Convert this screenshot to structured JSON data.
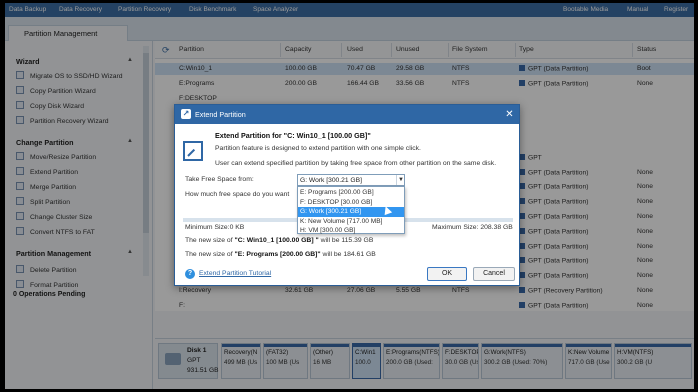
{
  "menu": [
    "Data Backup",
    "Data Recovery",
    "Partition Recovery",
    "Disk Benchmark",
    "Space Analyzer",
    "Bootable Media",
    "Manual",
    "Register"
  ],
  "tab": "Partition Management",
  "sidebar": {
    "wizard_title": "Wizard",
    "wizard_items": [
      "Migrate OS to SSD/HD Wizard",
      "Copy Partition Wizard",
      "Copy Disk Wizard",
      "Partition Recovery Wizard"
    ],
    "change_title": "Change Partition",
    "change_items": [
      "Move/Resize Partition",
      "Extend Partition",
      "Merge Partition",
      "Split Partition",
      "Change Cluster Size",
      "Convert NTFS to FAT"
    ],
    "manage_title": "Partition Management",
    "manage_items": [
      "Delete Partition",
      "Format Partition"
    ],
    "pending": "0 Operations Pending"
  },
  "table": {
    "headers": [
      "Partition",
      "Capacity",
      "Used",
      "Unused",
      "File System",
      "Type",
      "Status"
    ],
    "rows": [
      {
        "partition": "C:Win10_1",
        "capacity": "100.00 GB",
        "used": "70.47 GB",
        "unused": "29.58 GB",
        "fs": "NTFS",
        "type": "GPT (Data Partition)",
        "status": "Boot"
      },
      {
        "partition": "E:Programs",
        "capacity": "200.00 GB",
        "used": "166.44 GB",
        "unused": "33.56 GB",
        "fs": "NTFS",
        "type": "GPT (Data Partition)",
        "status": "None"
      },
      {
        "partition": "F:DESKTOP",
        "capacity": "",
        "used": "",
        "unused": "",
        "fs": "",
        "type": "",
        "status": ""
      },
      {
        "partition": "",
        "capacity": "",
        "used": "",
        "unused": "",
        "fs": "",
        "type": "",
        "status": ""
      },
      {
        "partition": "",
        "capacity": "",
        "used": "",
        "unused": "",
        "fs": "",
        "type": "",
        "status": ""
      },
      {
        "partition": "",
        "capacity": "",
        "used": "",
        "unused": "",
        "fs": "",
        "type": "",
        "status": ""
      },
      {
        "partition": "",
        "capacity": "",
        "used": "",
        "unused": "",
        "fs": "",
        "type": "GPT",
        "status": ""
      },
      {
        "partition": "",
        "capacity": "",
        "used": "",
        "unused": "",
        "fs": "",
        "type": "GPT (Data Partition)",
        "status": "None"
      },
      {
        "partition": "",
        "capacity": "",
        "used": "",
        "unused": "",
        "fs": "",
        "type": "GPT (Data Partition)",
        "status": "None"
      },
      {
        "partition": "",
        "capacity": "",
        "used": "",
        "unused": "",
        "fs": "",
        "type": "GPT (Data Partition)",
        "status": "None"
      },
      {
        "partition": "",
        "capacity": "",
        "used": "",
        "unused": "",
        "fs": "",
        "type": "GPT (Data Partition)",
        "status": "None"
      },
      {
        "partition": "",
        "capacity": "",
        "used": "",
        "unused": "",
        "fs": "",
        "type": "GPT (Data Partition)",
        "status": "None"
      },
      {
        "partition": "",
        "capacity": "",
        "used": "",
        "unused": "",
        "fs": "",
        "type": "GPT (Data Partition)",
        "status": "None"
      },
      {
        "partition": "",
        "capacity": "",
        "used": "",
        "unused": "",
        "fs": "",
        "type": "GPT (Data Partition)",
        "status": "None"
      },
      {
        "partition": "",
        "capacity": "",
        "used": "",
        "unused": "",
        "fs": "",
        "type": "GPT (Data Partition)",
        "status": "None"
      },
      {
        "partition": "I:Recovery",
        "capacity": "32.61 GB",
        "used": "27.06 GB",
        "unused": "5.55 GB",
        "fs": "NTFS",
        "type": "GPT (Recovery Partition)",
        "status": "None"
      },
      {
        "partition": "F:",
        "capacity": "",
        "used": "",
        "unused": "",
        "fs": "",
        "type": "GPT (Data Partition)",
        "status": "None"
      }
    ]
  },
  "diskmap": {
    "disk_name": "Disk 1",
    "disk_type": "GPT",
    "disk_size": "931.51 GB",
    "blocks": [
      {
        "name": "Recovery(N",
        "size": "499 MB (Us"
      },
      {
        "name": "(FAT32)",
        "size": "100 MB (Us"
      },
      {
        "name": "(Other)",
        "size": "16 MB"
      },
      {
        "name": "C:Win1",
        "size": "100.0"
      },
      {
        "name": "E:Programs(NTFS)",
        "size": "200.0 GB (Used:"
      },
      {
        "name": "F:DESKTOP(NTFS)",
        "size": "30.0 GB (Use"
      },
      {
        "name": "G:Work(NTFS)",
        "size": "300.2 GB (Used: 70%)"
      },
      {
        "name": "K:New Volume",
        "size": "717.0 GB (Use"
      },
      {
        "name": "H:VM(NTFS)",
        "size": "300.2 GB (U"
      }
    ]
  },
  "dialog": {
    "title": "Extend Partition",
    "heading": "Extend Partition for \"C: Win10_1 [100.00 GB]\"",
    "desc1": "Partition feature is designed to extend partition with one simple click.",
    "desc2": "User can extend specified partition by taking free space from other partition on the same disk.",
    "take_label": "Take Free Space from:",
    "selected": "G: Work [300.21 GB]",
    "how_much_label": "How much free space do you want",
    "options": [
      "E: Programs [200.00 GB]",
      "F: DESKTOP [30.00 GB]",
      "G: Work [300.21 GB]",
      "K: New Volume [717.00 MB]",
      "H: VM [300.00 GB]"
    ],
    "min_size": "Minimum Size:0 KB",
    "max_size": "Maximum Size: 208.38 GB",
    "new_c_pre": "The new size of ",
    "new_c_name": "\"C: Win10_1 [100.00 GB] \"",
    "new_c_post": " will be 115.39 GB",
    "new_e_pre": "The new size of ",
    "new_e_name": "\"E: Programs [200.00 GB]\"",
    "new_e_post": " will be 184.61 GB",
    "tutorial": "Extend Partition Tutorial",
    "ok": "OK",
    "cancel": "Cancel"
  }
}
